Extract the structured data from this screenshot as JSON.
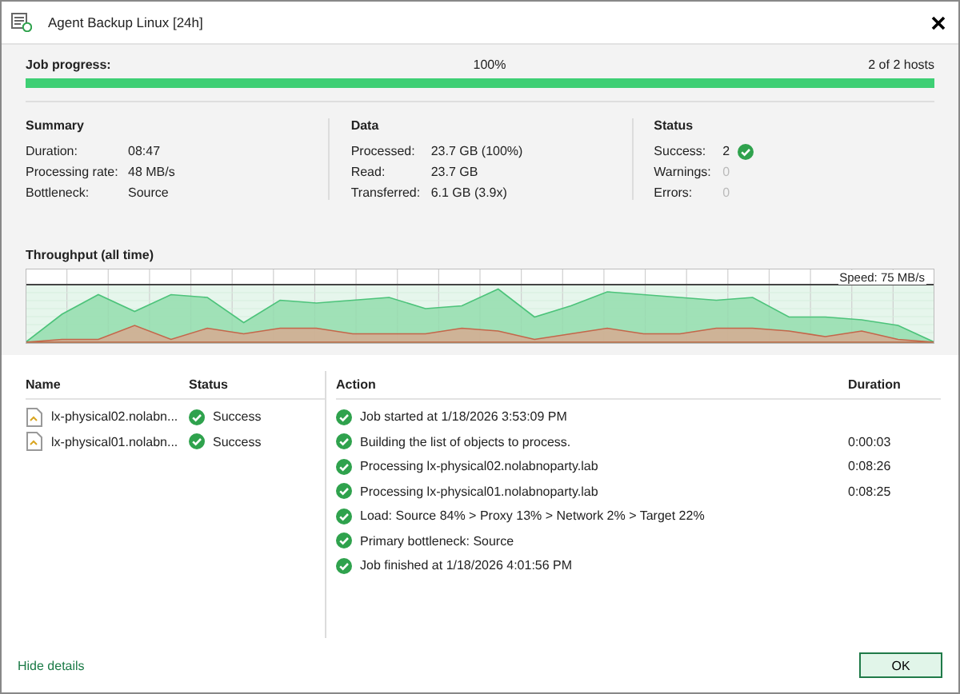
{
  "window": {
    "title": "Agent Backup Linux [24h]"
  },
  "progress": {
    "label": "Job progress:",
    "percent": "100%",
    "hosts": "2 of 2 hosts",
    "level": 1
  },
  "summary": {
    "title": "Summary",
    "items": [
      {
        "label": "Duration:",
        "value": "08:47"
      },
      {
        "label": "Processing rate:",
        "value": "48 MB/s"
      },
      {
        "label": "Bottleneck:",
        "value": "Source"
      }
    ]
  },
  "data": {
    "title": "Data",
    "items": [
      {
        "label": "Processed:",
        "value": "23.7 GB (100%)"
      },
      {
        "label": "Read:",
        "value": "23.7 GB"
      },
      {
        "label": "Transferred:",
        "value": "6.1 GB (3.9x)"
      }
    ]
  },
  "status": {
    "title": "Status",
    "items": [
      {
        "label": "Success:",
        "value": "2",
        "dimmed": false,
        "ok": true
      },
      {
        "label": "Warnings:",
        "value": "0",
        "dimmed": true,
        "ok": false
      },
      {
        "label": "Errors:",
        "value": "0",
        "dimmed": true,
        "ok": false
      }
    ]
  },
  "throughput": {
    "title": "Throughput (all time)",
    "speed": "Speed: 75 MB/s"
  },
  "hosts": {
    "columns": [
      "Name",
      "Status"
    ],
    "rows": [
      {
        "name": "lx-physical02.nolabn...",
        "status": "Success",
        "ok": true
      },
      {
        "name": "lx-physical01.nolabn...",
        "status": "Success",
        "ok": true
      }
    ]
  },
  "log": {
    "columns": [
      "Action",
      "Duration"
    ],
    "rows": [
      {
        "action": "Job started at 1/18/2026 3:53:09 PM",
        "ok": true
      },
      {
        "action": "Building the list of objects to process.",
        "duration": "0:00:03",
        "ok": true
      },
      {
        "action": "Processing lx-physical02.nolabnoparty.lab",
        "duration": "0:08:26",
        "ok": true
      },
      {
        "action": "Processing lx-physical01.nolabnoparty.lab",
        "duration": "0:08:25",
        "ok": true
      },
      {
        "action": "Load: Source 84% > Proxy 13% > Network 2% > Target 22%",
        "ok": true
      },
      {
        "action": "Primary bottleneck: Source",
        "ok": true
      },
      {
        "action": "Job finished at 1/18/2026 4:01:56 PM",
        "ok": true
      }
    ]
  },
  "footer": {
    "link": "Hide details",
    "button": "OK"
  }
}
